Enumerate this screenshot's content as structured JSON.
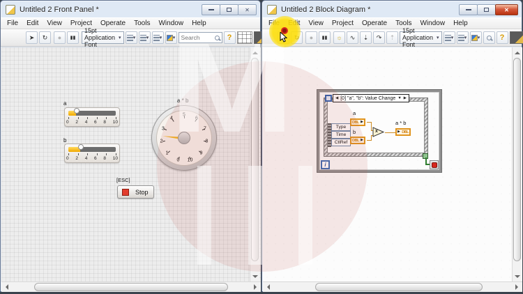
{
  "windows": {
    "left": {
      "title": "Untitled 2 Front Panel *"
    },
    "right": {
      "title": "Untitled 2 Block Diagram *"
    }
  },
  "menu_items": [
    "File",
    "Edit",
    "View",
    "Project",
    "Operate",
    "Tools",
    "Window",
    "Help"
  ],
  "toolbar": {
    "font_selector": "15pt Application Font",
    "search_placeholder": "Search",
    "help_label": "?"
  },
  "icons": {
    "run": "➤",
    "run_continuous": "↻",
    "abort": "●",
    "pause": "▮▮",
    "highlight_execution": "☼",
    "retain_wire_values": "∿",
    "step_into": "⇣",
    "step_over": "↷",
    "step_out": "⇡",
    "dropdown": "▾",
    "close": "✕",
    "arrow_left": "◀",
    "arrow_right": "▶",
    "arrow_down": "▼",
    "terminal_arrow": "▶",
    "multiply": "x"
  },
  "front_panel": {
    "slider_a": {
      "label": "a",
      "value": 1.6,
      "scale": [
        "0",
        "2",
        "4",
        "6",
        "8",
        "10"
      ]
    },
    "slider_b": {
      "label": "b",
      "value": 2.3,
      "scale": [
        "0",
        "2",
        "4",
        "6",
        "8",
        "10"
      ]
    },
    "gauge": {
      "label": "a * b",
      "value": 2.5,
      "scale": [
        "0",
        "1",
        "2",
        "3",
        "4",
        "5",
        "6",
        "7",
        "8",
        "9",
        "10"
      ]
    },
    "stop_button": {
      "key_hint": "[ESC]",
      "label": "Stop"
    }
  },
  "block_diagram": {
    "event_case_header": "[0] \"a\", \"b\": Value Change",
    "event_fields": [
      "Type",
      "Time",
      "CtlRef"
    ],
    "terminal_a_label": "a",
    "terminal_b_label": "b",
    "output_label": "a * b",
    "terminal_type": "DBL",
    "iteration_label": "i"
  },
  "watermark": {
    "letter": "M"
  }
}
